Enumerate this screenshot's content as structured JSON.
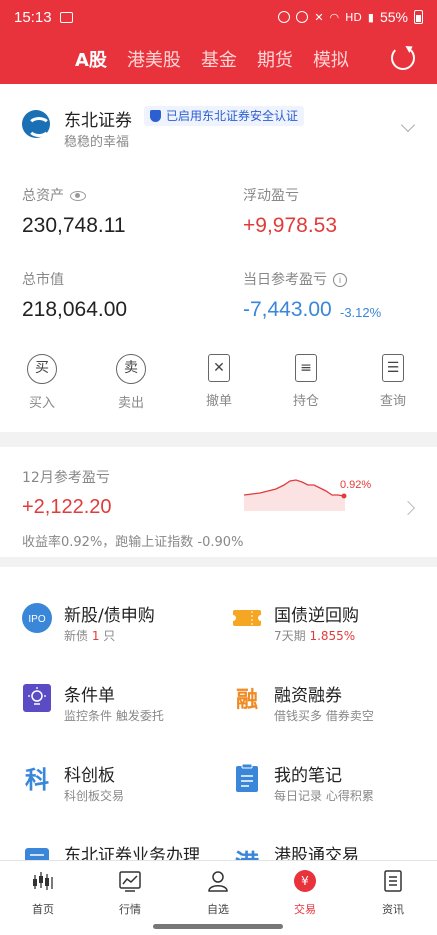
{
  "status_bar": {
    "time": "15:13",
    "network": "HD",
    "battery": "55%"
  },
  "nav": {
    "tabs": [
      "A股",
      "港美股",
      "基金",
      "期货",
      "模拟"
    ],
    "active_index": 0
  },
  "account": {
    "broker_name": "东北证券",
    "cert_badge": "已启用东北证券安全认证",
    "slogan": "稳稳的幸福",
    "total_assets_label": "总资产",
    "total_assets": "230,748.11",
    "floating_pnl_label": "浮动盈亏",
    "floating_pnl": "+9,978.53",
    "market_value_label": "总市值",
    "market_value": "218,064.00",
    "daily_pnl_label": "当日参考盈亏",
    "daily_pnl": "-7,443.00",
    "daily_pnl_pct": "-3.12%",
    "info_glyph": "i"
  },
  "actions": [
    {
      "label": "买入",
      "glyph": "买"
    },
    {
      "label": "卖出",
      "glyph": "卖"
    },
    {
      "label": "撤单",
      "glyph": "✕"
    },
    {
      "label": "持仓",
      "glyph": "≡"
    },
    {
      "label": "查询",
      "glyph": "☰"
    }
  ],
  "monthly": {
    "title": "12月参考盈亏",
    "value": "+2,122.20",
    "desc": "收益率0.92%，跑输上证指数 -0.90%",
    "chart_label": "0.92%"
  },
  "services": [
    {
      "title": "新股/债申购",
      "sub_prefix": "新债 ",
      "sub_hl": "1",
      "sub_suffix": " 只",
      "icon": "ipo-icon",
      "icon_text": "IPO"
    },
    {
      "title": "国债逆回购",
      "sub_prefix": "7天期 ",
      "sub_hl": "1.855%",
      "sub_suffix": "",
      "icon": "ticket-icon",
      "icon_text": ""
    },
    {
      "title": "条件单",
      "sub_prefix": "监控条件 触发委托",
      "sub_hl": "",
      "sub_suffix": "",
      "icon": "lightbulb-icon",
      "icon_text": ""
    },
    {
      "title": "融资融券",
      "sub_prefix": "借钱买多 借券卖空",
      "sub_hl": "",
      "sub_suffix": "",
      "icon": "margin-icon",
      "icon_text": "融"
    },
    {
      "title": "科创板",
      "sub_prefix": "科创板交易",
      "sub_hl": "",
      "sub_suffix": "",
      "icon": "star-market-icon",
      "icon_text": "科"
    },
    {
      "title": "我的笔记",
      "sub_prefix": "每日记录 心得积累",
      "sub_hl": "",
      "sub_suffix": "",
      "icon": "notes-icon",
      "icon_text": ""
    },
    {
      "title": "东北证券业务办理",
      "sub_prefix": "",
      "sub_hl": "",
      "sub_suffix": "",
      "icon": "business-icon",
      "icon_text": ""
    },
    {
      "title": "港股通交易",
      "sub_prefix": "",
      "sub_hl": "",
      "sub_suffix": "",
      "icon": "hk-connect-icon",
      "icon_text": "港"
    }
  ],
  "bottom_nav": [
    {
      "label": "首页",
      "icon": "home-chart-icon"
    },
    {
      "label": "行情",
      "icon": "market-icon"
    },
    {
      "label": "自选",
      "icon": "watchlist-icon"
    },
    {
      "label": "交易",
      "icon": "trade-icon",
      "glyph": "¥"
    },
    {
      "label": "资讯",
      "icon": "news-icon"
    }
  ],
  "colors": {
    "brand_red": "#e8323c",
    "profit_red": "#e23b3b",
    "loss_blue": "#3a86d8",
    "badge_blue": "#2c5fd0"
  }
}
